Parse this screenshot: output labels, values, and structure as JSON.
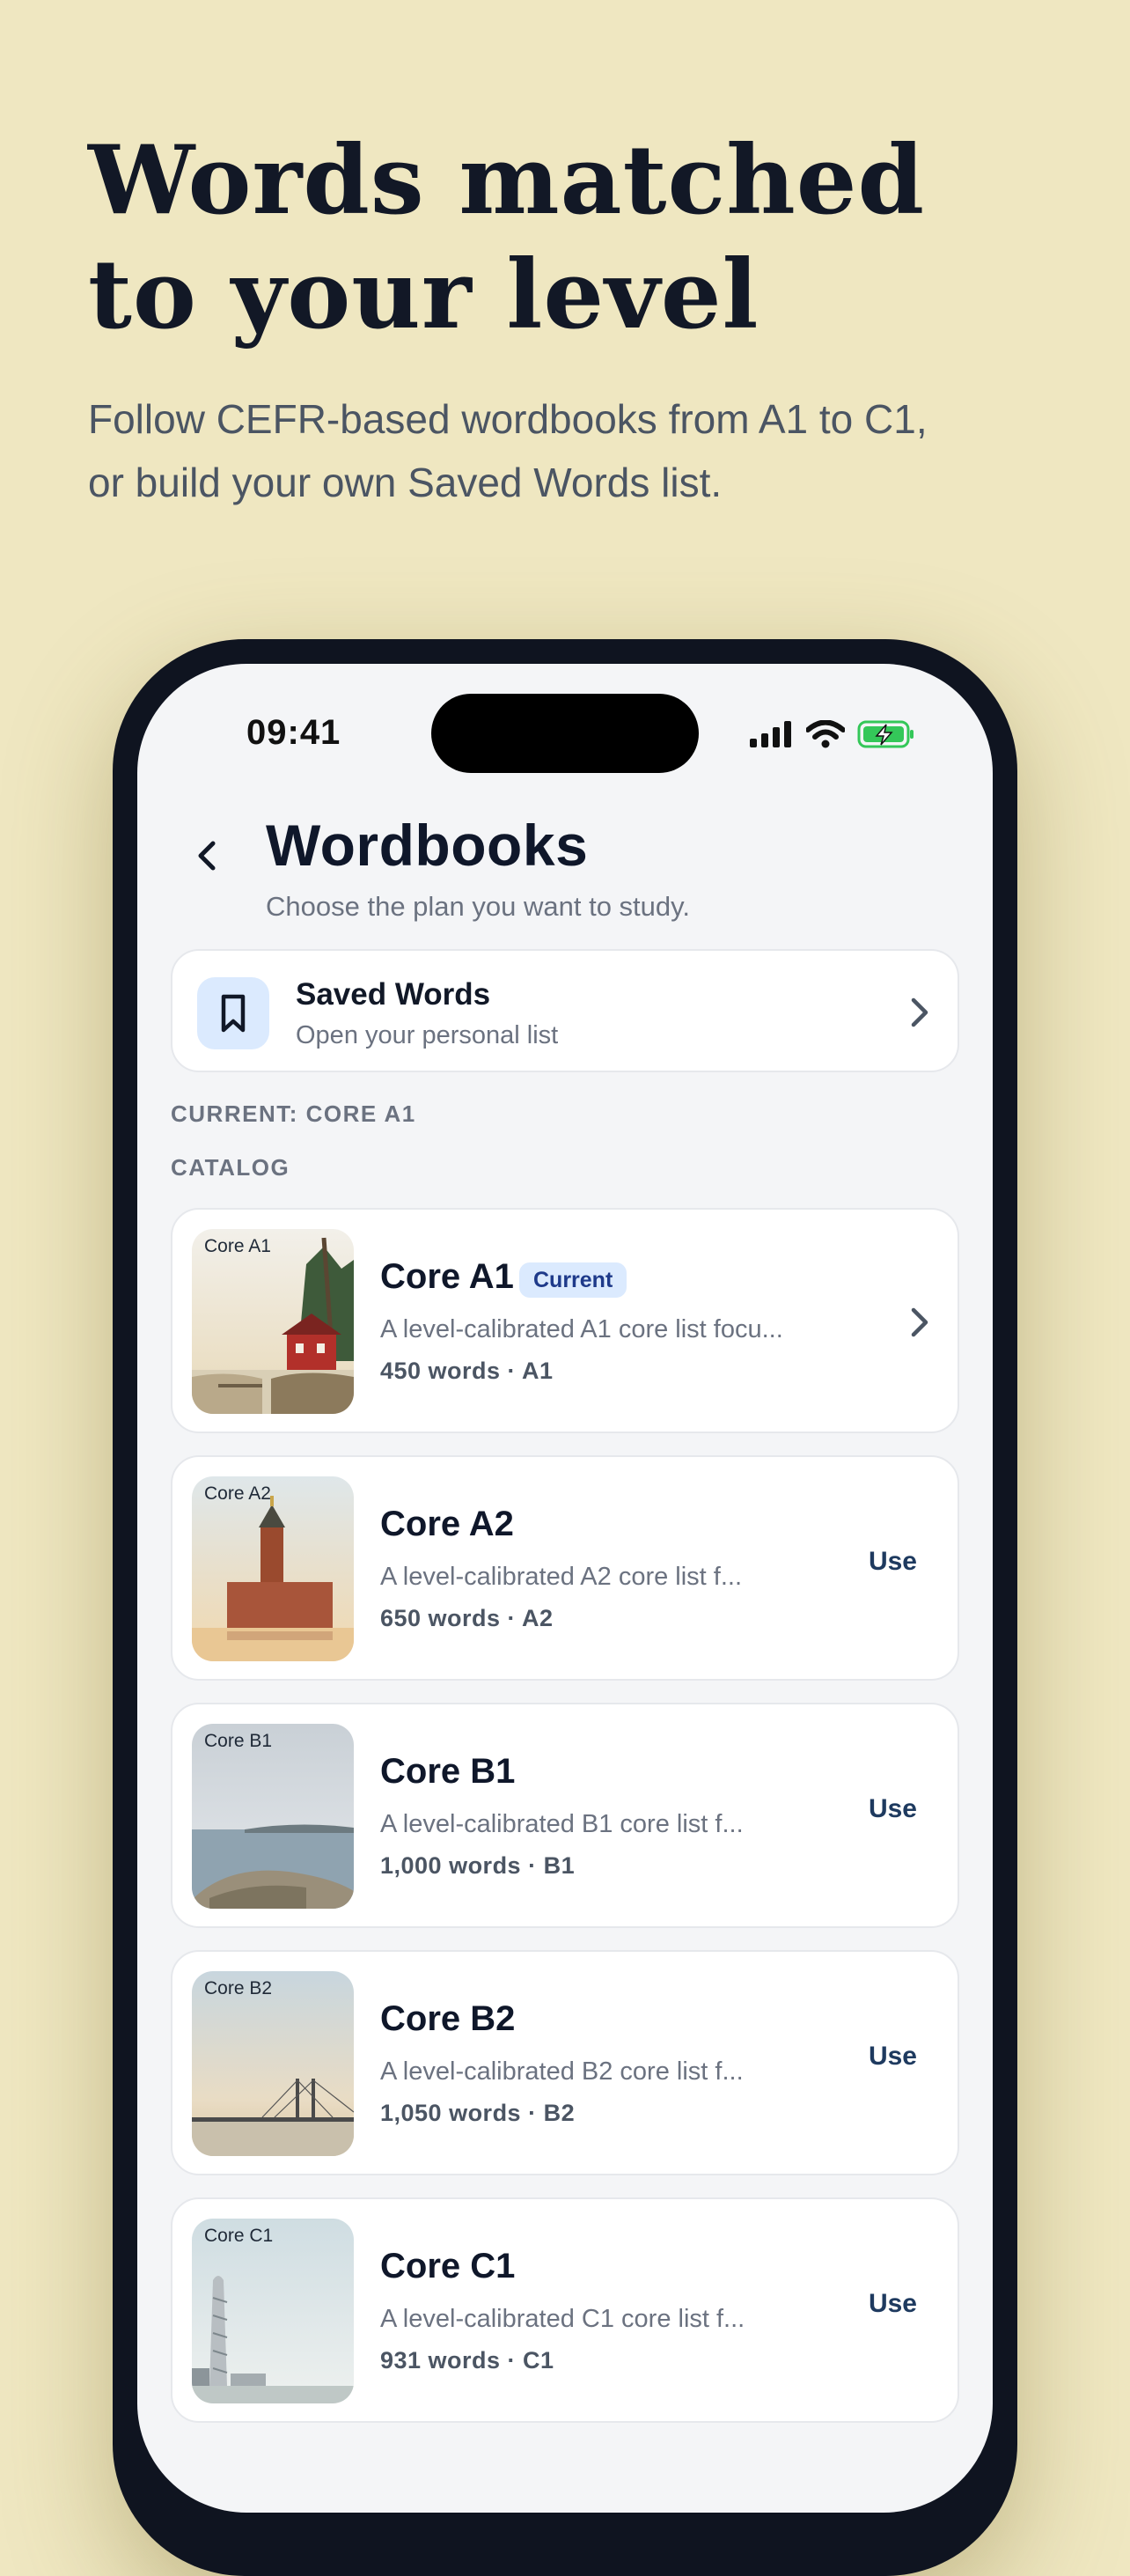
{
  "marketing": {
    "headline_line1": "Words matched",
    "headline_line2": "to your level",
    "subhead_line1": "Follow CEFR-based wordbooks from A1 to C1,",
    "subhead_line2": "or build your own Saved Words list."
  },
  "status_bar": {
    "time": "09:41",
    "icons": [
      "signal-icon",
      "wifi-icon",
      "battery-charging-icon"
    ]
  },
  "header": {
    "back_icon": "chevron-left-icon",
    "title": "Wordbooks",
    "subtitle": "Choose the plan you want to study."
  },
  "saved_words": {
    "icon": "bookmark-icon",
    "title": "Saved Words",
    "subtitle": "Open your personal list"
  },
  "current_label": "CURRENT: CORE A1",
  "catalog_label": "CATALOG",
  "books": [
    {
      "thumb_label": "Core A1",
      "title": "Core A1",
      "badge": "Current",
      "description": "A level-calibrated A1 core list focu...",
      "meta": "450 words · A1",
      "action": "chevron-right-icon"
    },
    {
      "thumb_label": "Core A2",
      "title": "Core A2",
      "description": "A level-calibrated A2 core list f...",
      "meta": "650 words · A2",
      "action_label": "Use"
    },
    {
      "thumb_label": "Core B1",
      "title": "Core B1",
      "description": "A level-calibrated B1 core list f...",
      "meta": "1,000 words · B1",
      "action_label": "Use"
    },
    {
      "thumb_label": "Core B2",
      "title": "Core B2",
      "description": "A level-calibrated B2 core list f...",
      "meta": "1,050 words · B2",
      "action_label": "Use"
    },
    {
      "thumb_label": "Core C1",
      "title": "Core C1",
      "description": "A level-calibrated C1 core list f...",
      "meta": "931 words · C1",
      "action_label": "Use"
    }
  ],
  "colors": {
    "background": "#efe7c1",
    "accent": "#1e3a5f",
    "badge_bg": "#dbeafe",
    "battery_green": "#34c759"
  }
}
